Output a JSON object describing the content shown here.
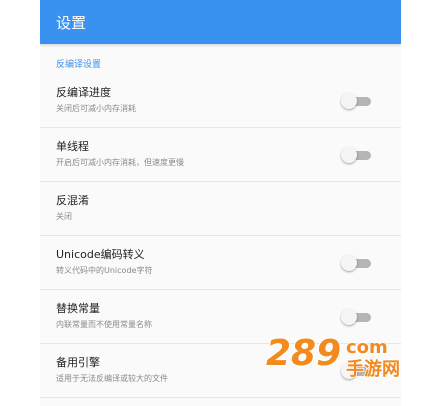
{
  "appbar": {
    "title": "设置"
  },
  "section": {
    "title": "反编译设置"
  },
  "settings": [
    {
      "title": "反编译进度",
      "subtitle": "关闭后可减小内存消耗",
      "switch": "off"
    },
    {
      "title": "单线程",
      "subtitle": "开启后可减小内存消耗，但速度更慢",
      "switch": "off"
    },
    {
      "title": "反混淆",
      "subtitle": "关闭"
    },
    {
      "title": "Unicode编码转义",
      "subtitle": "转义代码中的Unicode字符",
      "switch": "off"
    },
    {
      "title": "替换常量",
      "subtitle": "内联常量而不使用常量名称",
      "switch": "off"
    },
    {
      "title": "备用引擎",
      "subtitle": "适用于无法反编译或较大的文件",
      "switch": "off"
    }
  ],
  "watermark": {
    "brand": "289",
    "suffix": "com",
    "label": "手游网"
  },
  "colors": {
    "primary": "#3a92f0",
    "watermark": "#f28a1e"
  }
}
